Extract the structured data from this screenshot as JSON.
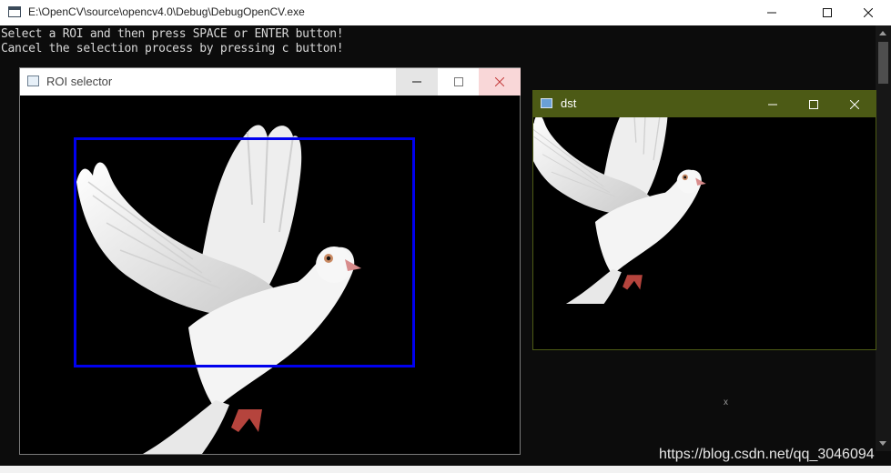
{
  "console": {
    "title": "E:\\OpenCV\\source\\opencv4.0\\Debug\\DebugOpenCV.exe",
    "lines": [
      "Select a ROI and then press SPACE or ENTER button!",
      "Cancel the selection process by pressing c button!"
    ],
    "stray_char": "x",
    "watermark": "https://blog.csdn.net/qq_3046094"
  },
  "roi_window": {
    "title": "ROI selector",
    "image": "dove-image",
    "selection_color": "#0000ee"
  },
  "dst_window": {
    "title": "dst",
    "titlebar_color": "#4c5a15",
    "image": "dove-image-cropped"
  },
  "icons": {
    "minimize": "minimize-icon",
    "maximize": "maximize-icon",
    "close": "close-icon",
    "app": "window-app-icon"
  }
}
